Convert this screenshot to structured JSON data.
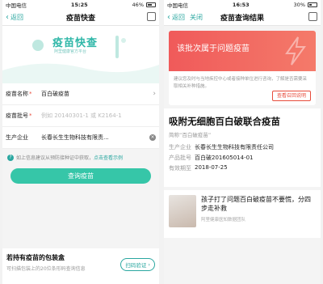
{
  "left": {
    "status": {
      "carrier": "中国电信",
      "time": "15:25",
      "battery": "46%"
    },
    "nav": {
      "back": "返回",
      "title": "疫苗快查"
    },
    "hero": {
      "logo": "疫苗快查",
      "slogan": "阿里健康官方平台"
    },
    "form": {
      "name_label": "疫苗名称",
      "name_value": "百白破疫苗",
      "batch_label": "疫苗批号",
      "batch_placeholder": "例如 20140301-1 或 K2164-1",
      "maker_label": "生产企业",
      "maker_value": "长春长生生物科技有限责..."
    },
    "tip": {
      "text": "如上信息建议从预防接种证中获取，",
      "link": "点击查看示例"
    },
    "query_button": "查询疫苗",
    "bottom": {
      "title": "若持有疫苗的包装盒",
      "subtitle": "可扫描包装上的20位条形码查询信息",
      "scan_button": "扫码验证"
    }
  },
  "right": {
    "status": {
      "carrier": "中国电信",
      "time": "16:53",
      "battery": "30%"
    },
    "nav": {
      "back": "返回",
      "close": "关闭",
      "title": "疫苗查询结果"
    },
    "alert": {
      "title": "该批次属于问题疫苗",
      "body": "建议您及时与当地疾控中心或者接种单位进行咨询，了解是否需要采取相关补种措施。",
      "button": "查看召回说明"
    },
    "vaccine": {
      "name": "吸附无细胞百白破联合疫苗",
      "alias": "简称“百白破疫苗”",
      "maker_label": "生产企业",
      "maker_value": "长春长生生物科技有限责任公司",
      "batch_label": "产品批号",
      "batch_value": "百白破201605014-01",
      "expiry_label": "有效期至",
      "expiry_value": "2018-07-25"
    },
    "article": {
      "title": "孩子打了问题百白破疫苗不要慌，分四步走补救",
      "source": "阿里健康医知数据团队"
    }
  }
}
